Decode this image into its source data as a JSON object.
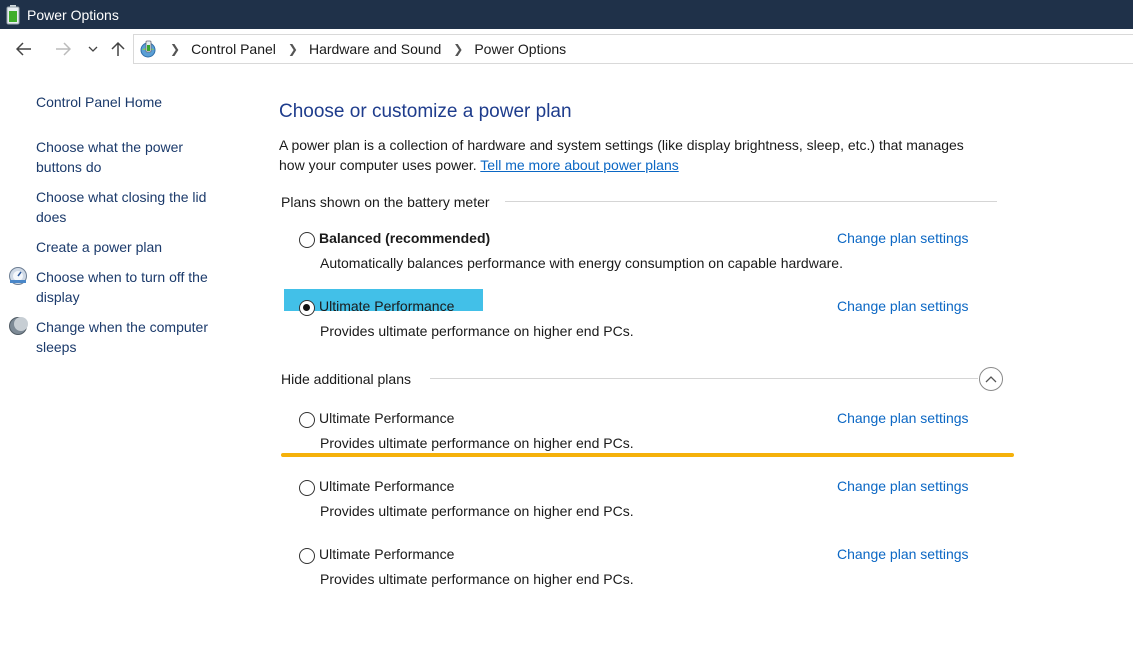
{
  "window": {
    "title": "Power Options"
  },
  "breadcrumb": [
    "Control Panel",
    "Hardware and Sound",
    "Power Options"
  ],
  "sidebar": {
    "home": "Control Panel Home",
    "links": [
      "Choose what the power buttons do",
      "Choose what closing the lid does",
      "Create a power plan",
      "Choose when to turn off the display",
      "Change when the computer sleeps"
    ]
  },
  "main": {
    "title": "Choose or customize a power plan",
    "intro": "A power plan is a collection of hardware and system settings (like display brightness, sleep, etc.) that manages how your computer uses power.",
    "intro_link": "Tell me more about power plans",
    "section_battery": "Plans shown on the battery meter",
    "section_additional": "Hide additional plans",
    "change_label": "Change plan settings",
    "plans": [
      {
        "name": "Balanced (recommended)",
        "desc": "Automatically balances performance with energy consumption on capable hardware.",
        "selected": false
      },
      {
        "name": "Ultimate Performance",
        "desc": "Provides ultimate performance on higher end PCs.",
        "selected": true
      },
      {
        "name": "Ultimate Performance",
        "desc": "Provides ultimate performance on higher end PCs.",
        "selected": false
      },
      {
        "name": "Ultimate Performance",
        "desc": "Provides ultimate performance on higher end PCs.",
        "selected": false
      },
      {
        "name": "Ultimate Performance",
        "desc": "Provides ultimate performance on higher end PCs.",
        "selected": false
      }
    ]
  },
  "colors": {
    "titlebar": "#1f3149",
    "link": "#0b67c4",
    "heading": "#1e3c8c",
    "highlight": "#42c0e8",
    "annotation": "#f5b10a"
  },
  "icons": [
    "battery-icon",
    "back-arrow-icon",
    "forward-arrow-icon",
    "chevron-down-icon",
    "up-arrow-icon",
    "power-options-icon",
    "display-icon",
    "moon-icon",
    "collapse-chevron-icon"
  ]
}
